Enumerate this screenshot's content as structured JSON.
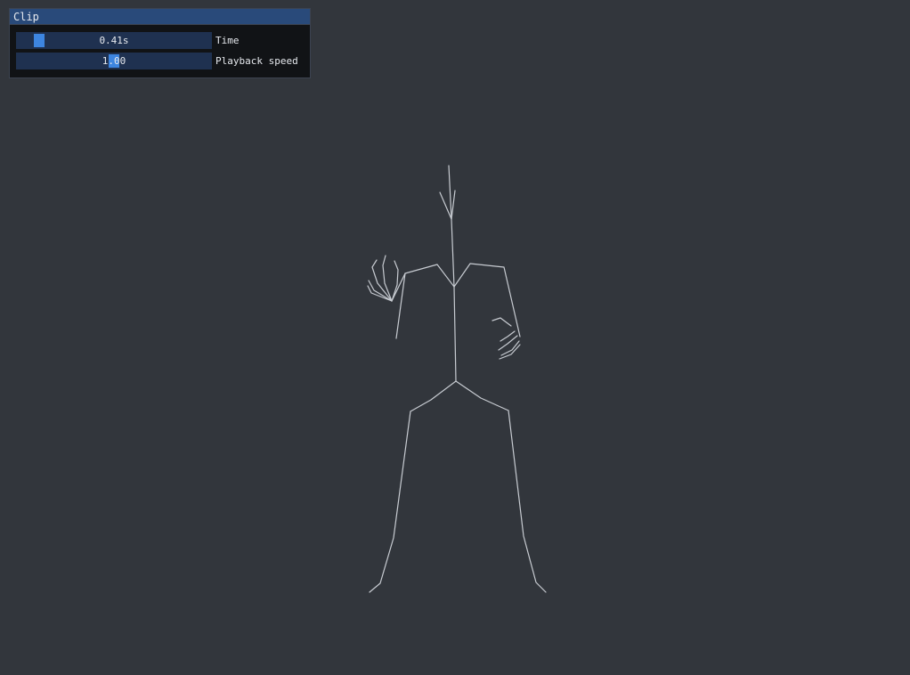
{
  "panel": {
    "title": "Clip",
    "time": {
      "label": "Time",
      "value_text": "0.41s",
      "fraction": 0.08
    },
    "speed": {
      "label": "Playback speed",
      "value_text": "1.00",
      "fraction": 0.5
    }
  },
  "colors": {
    "background": "#32363c",
    "panel_bg": "#111316",
    "title_bar": "#294a7a",
    "slider_bg": "#1f3150",
    "slider_grab": "#3d85e0",
    "bone": "#c8ccd2"
  }
}
